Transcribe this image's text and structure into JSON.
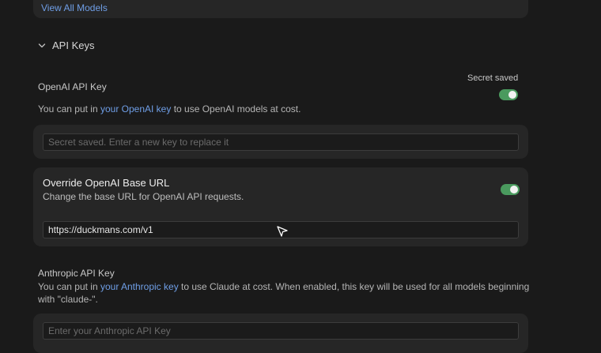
{
  "models_card": {
    "view_all_label": "View All Models"
  },
  "api_keys_section": {
    "title": "API Keys",
    "openai": {
      "label": "OpenAI API Key",
      "status": "Secret saved",
      "desc_prefix": "You can put in ",
      "desc_link": "your OpenAI key",
      "desc_suffix": " to use OpenAI models at cost.",
      "toggle_on": true,
      "input_value": "",
      "input_placeholder": "Secret saved. Enter a new key to replace it"
    },
    "override": {
      "title": "Override OpenAI Base URL",
      "desc": "Change the base URL for OpenAI API requests.",
      "toggle_on": true,
      "input_value": "https://duckmans.com/v1"
    },
    "anthropic": {
      "label": "Anthropic API Key",
      "desc_prefix": "You can put in ",
      "desc_link": "your Anthropic key",
      "desc_suffix": " to use Claude at cost. When enabled, this key will be used for all models beginning",
      "desc_line2": "with \"claude-\".",
      "input_value": "",
      "input_placeholder": "Enter your Anthropic API Key"
    }
  },
  "colors": {
    "background": "#1a1a1a",
    "card": "#262626",
    "link": "#6f9ee6",
    "toggle_on": "#4a9a5e"
  }
}
